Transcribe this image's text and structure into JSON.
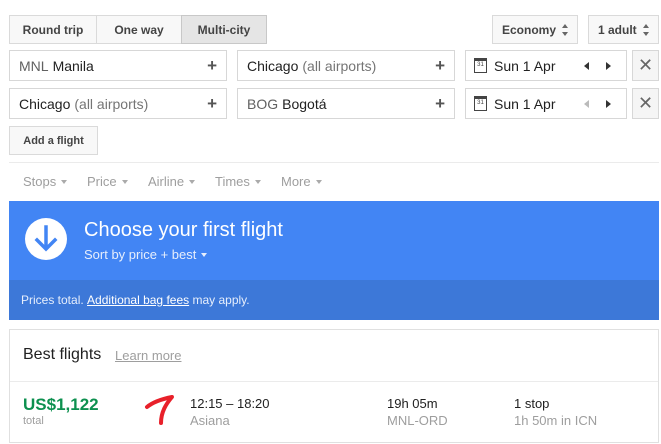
{
  "trip_types": [
    "Round trip",
    "One way",
    "Multi-city"
  ],
  "trip_type_selected": "Multi-city",
  "cabin_class": "Economy",
  "passengers": "1 adult",
  "legs": [
    {
      "from_code": "MNL",
      "from_name": "Manila",
      "from_extra": "",
      "to_code": "",
      "to_name": "Chicago",
      "to_extra": "(all airports)",
      "date": "Sun 1 Apr"
    },
    {
      "from_code": "",
      "from_name": "Chicago",
      "from_extra": "(all airports)",
      "to_code": "BOG",
      "to_name": "Bogotá",
      "to_extra": "",
      "date": "Sun 1 Apr"
    }
  ],
  "add_flight_label": "Add a flight",
  "filters": [
    "Stops",
    "Price",
    "Airline",
    "Times",
    "More"
  ],
  "banner": {
    "title": "Choose your first flight",
    "sort_label": "Sort by price + best",
    "note_prefix": "Prices total.",
    "note_link": "Additional bag fees",
    "note_suffix": "may apply."
  },
  "results": {
    "section_title": "Best flights",
    "learn_more": "Learn more",
    "flights": [
      {
        "price": "US$1,122",
        "price_note": "total",
        "times": "12:15 – 18:20",
        "airline": "Asiana",
        "duration": "19h 05m",
        "route": "MNL-ORD",
        "stops": "1 stop",
        "layover": "1h 50m in ICN"
      }
    ]
  },
  "colors": {
    "banner": "#4285f4",
    "banner_strip": "#3d78d8",
    "price_green": "#0d904f",
    "annotation_red": "#e8202a"
  }
}
